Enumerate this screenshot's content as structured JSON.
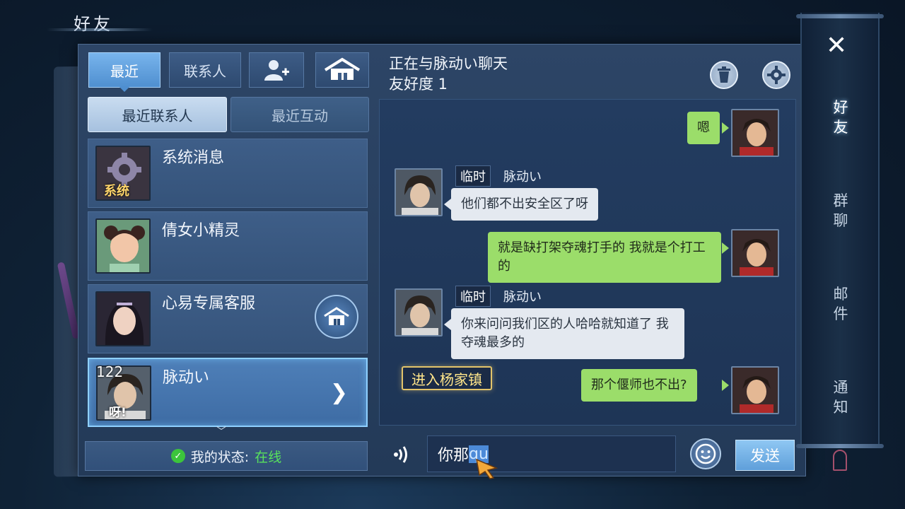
{
  "window": {
    "title": "好友"
  },
  "top_tabs": [
    {
      "label": "最近",
      "active": true
    },
    {
      "label": "联系人",
      "active": false
    },
    {
      "icon": "add-friend-icon"
    },
    {
      "icon": "home-icon"
    }
  ],
  "sub_tabs": [
    {
      "label": "最近联系人",
      "active": true
    },
    {
      "label": "最近互动",
      "active": false
    }
  ],
  "contacts": [
    {
      "name": "系统消息",
      "avatar_label": "系统",
      "avatar": "gear-avatar"
    },
    {
      "name": "倩女小精灵",
      "avatar": "sprite-girl-avatar"
    },
    {
      "name": "心易专属客服",
      "avatar": "service-avatar",
      "has_home_button": true
    },
    {
      "name": "脉动い",
      "level": "122",
      "avatar_label": "呀!",
      "selected": true
    }
  ],
  "status": {
    "label": "我的状态:",
    "value": "在线"
  },
  "chat_header": {
    "line1": "正在与脉动い聊天",
    "line2": "友好度 1"
  },
  "messages": [
    {
      "side": "right",
      "text": "嗯"
    },
    {
      "side": "left",
      "tag": "临时",
      "sender": "脉动い",
      "text": "他们都不出安全区了呀"
    },
    {
      "side": "right",
      "text": "就是缺打架夺魂打手的 我就是个打工的"
    },
    {
      "side": "left",
      "tag": "临时",
      "sender": "脉动い",
      "text": "你来问问我们区的人哈哈就知道了 我夺魂最多的"
    },
    {
      "side": "right",
      "text": "那个偃师也不出?"
    }
  ],
  "location_badge": "进入杨家镇",
  "input": {
    "text": "你那",
    "ime_text": "qu"
  },
  "send_label": "发送",
  "side_nav": [
    {
      "label": "好友",
      "active": true
    },
    {
      "label": "群聊",
      "active": false
    },
    {
      "label": "邮件",
      "active": false
    },
    {
      "label": "通知",
      "active": false
    }
  ],
  "colors": {
    "accent": "#4f8fd0",
    "my_bubble": "#9bdd6a",
    "their_bubble": "#e4e9f0",
    "online": "#58e25c",
    "location_border": "#e3c46a"
  }
}
